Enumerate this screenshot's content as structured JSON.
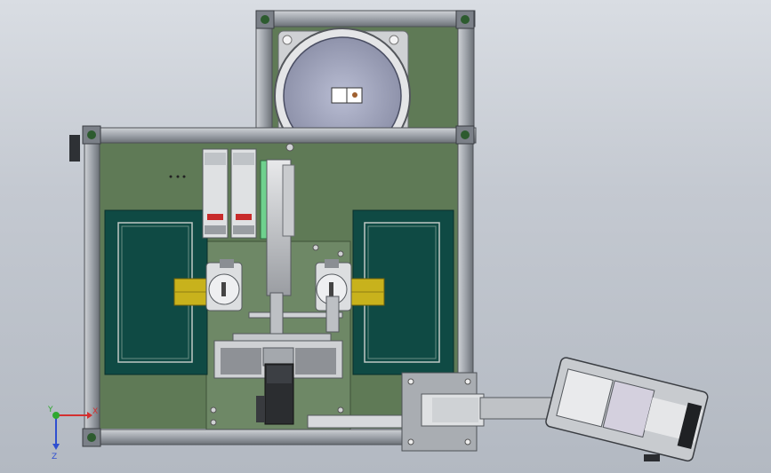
{
  "colors": {
    "frame": "#a7acb3",
    "frame_dark": "#5d6268",
    "base_plate": "#5f7a56",
    "base_plate_light": "#6f8a66",
    "tray": "#0f4a44",
    "tray_border": "#0a2f2b",
    "rail_yellow": "#c8b21c",
    "metal_light": "#d4d6d9",
    "metal_mid": "#b7babe",
    "metal_dark": "#6a6d72",
    "controller_red": "#c82b2b",
    "axis_x": "#d33030",
    "axis_y": "#2fa82f",
    "axis_z": "#2f4fd0",
    "green_glass": "#6fd18e"
  },
  "axes": {
    "x_label": "X",
    "y_label": "Y",
    "z_label": "Z"
  }
}
